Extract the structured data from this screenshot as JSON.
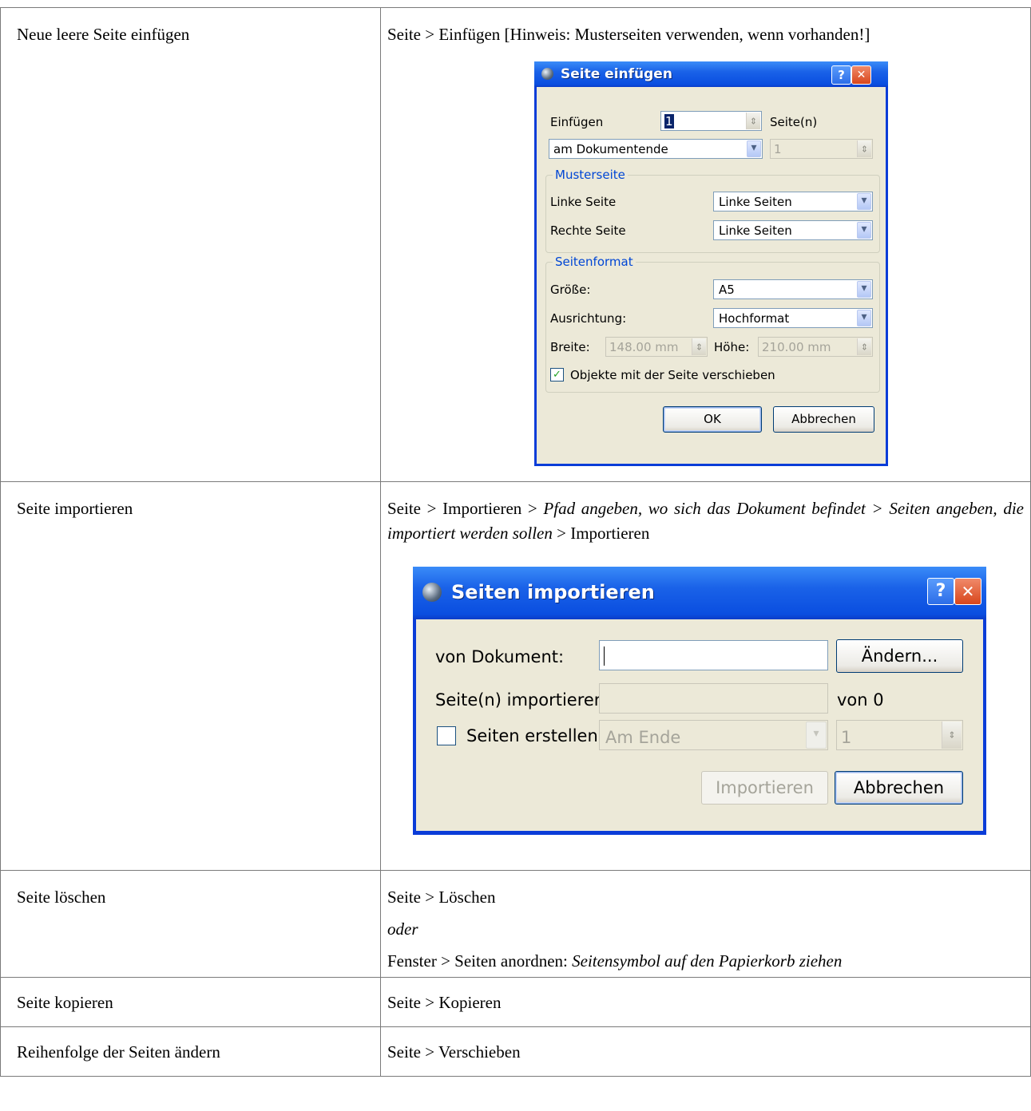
{
  "rows": [
    {
      "task": "Neue leere Seite einfügen",
      "instruction": "Seite > Einfügen [Hinweis: Musterseiten verwenden, wenn vorhanden!]"
    },
    {
      "task": "Seite importieren",
      "instr_part1": "Seite > Importieren > ",
      "instr_italic": "Pfad angeben, wo sich das Dokument befindet > Seiten angeben, die importiert werden sollen",
      "instr_part2": " > Importieren"
    },
    {
      "task": "Seite löschen",
      "line1": "Seite > Löschen",
      "line2": "oder",
      "line3_plain": "Fenster > Seiten anordnen: ",
      "line3_italic": "Seitensymbol auf den Papierkorb ziehen"
    },
    {
      "task": "Seite kopieren",
      "instruction": "Seite > Kopieren"
    },
    {
      "task": "Reihenfolge der Seiten ändern",
      "instruction": "Seite > Verschieben"
    }
  ],
  "dialog_insert": {
    "title": "Seite einfügen",
    "help": "?",
    "close": "✕",
    "insert_label": "Einfügen",
    "insert_count": "1",
    "pages_label": "Seite(n)",
    "position": "am Dokumentende",
    "position_page": "1",
    "group_master": "Musterseite",
    "left_page_label": "Linke Seite",
    "left_page_value": "Linke Seiten",
    "right_page_label": "Rechte Seite",
    "right_page_value": "Linke Seiten",
    "group_format": "Seitenformat",
    "size_label": "Größe:",
    "size_value": "A5",
    "orientation_label": "Ausrichtung:",
    "orientation_value": "Hochformat",
    "width_label": "Breite:",
    "width_value": "148.00 mm",
    "height_label": "Höhe:",
    "height_value": "210.00 mm",
    "move_objects_label": "Objekte mit der Seite verschieben",
    "move_objects_checked": true,
    "ok": "OK",
    "cancel": "Abbrechen"
  },
  "dialog_import": {
    "title": "Seiten importieren",
    "help": "?",
    "close": "✕",
    "doc_label": "von Dokument:",
    "doc_value": "",
    "change_button": "Ändern...",
    "pages_label": "Seite(n) importieren:",
    "pages_value": "",
    "of_label": "von 0",
    "create_label": "Seiten erstellen",
    "create_checked": false,
    "create_position": "Am Ende",
    "create_page": "1",
    "import_button": "Importieren",
    "cancel": "Abbrechen"
  },
  "colors": {
    "xp_title": "#0a4ee0",
    "xp_face": "#ece9d8",
    "group_label": "#0046d5",
    "table_border": "#7a7a7a"
  }
}
